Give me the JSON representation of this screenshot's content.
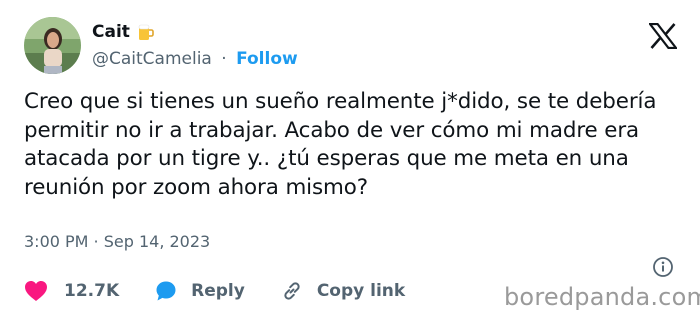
{
  "author": {
    "display_name": "Cait",
    "emoji_icon": "beer-mug-icon",
    "handle": "@CaitCamelia",
    "separator": "·",
    "follow_label": "Follow"
  },
  "tweet": {
    "text": "Creo que si tienes un sueño realmente j*dido, se te debería permitir no ir a trabajar. Acabo de ver cómo mi madre era atacada por un tigre y.. ¿tú esperas que me meta en una reunión por zoom ahora mismo?",
    "timestamp": "3:00 PM · Sep 14, 2023"
  },
  "actions": {
    "like_count": "12.7K",
    "reply_label": "Reply",
    "copy_link_label": "Copy link"
  },
  "icons": {
    "platform": "x-logo-icon",
    "info": "info-icon",
    "like": "heart-icon",
    "reply": "speech-bubble-icon",
    "copy": "link-icon"
  },
  "colors": {
    "like": "#f91880",
    "reply": "#1d9bf0",
    "follow": "#1d9bf0",
    "secondary_text": "#536471",
    "primary_text": "#0f1419"
  },
  "watermark": "boredpanda.com"
}
